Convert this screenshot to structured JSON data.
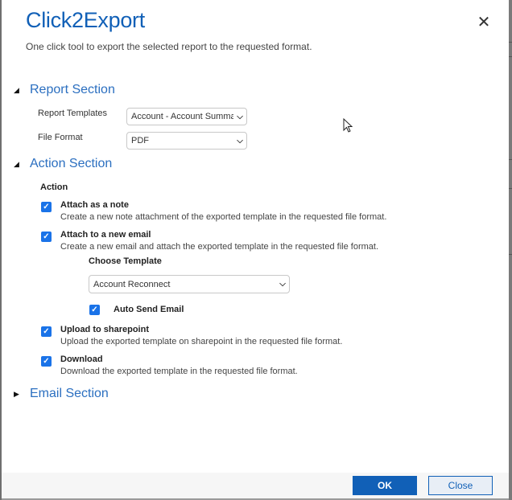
{
  "dialog": {
    "title": "Click2Export",
    "subtitle": "One click tool to export the selected report to the requested format.",
    "close_icon": "close-icon"
  },
  "report_section": {
    "title": "Report Section",
    "expanded": true,
    "fields": [
      {
        "label": "Report Templates",
        "value": "Account - Account Summary"
      },
      {
        "label": "File Format",
        "value": "PDF"
      }
    ]
  },
  "action_section": {
    "title": "Action Section",
    "expanded": true,
    "action_label": "Action",
    "options": [
      {
        "title": "Attach as a note",
        "desc": "Create a new note attachment of the exported template in the requested file format.",
        "checked": true
      },
      {
        "title": "Attach to a new email",
        "desc": "Create a new email and attach the exported template in the requested file format.",
        "checked": true
      },
      {
        "title": "Upload to sharepoint",
        "desc": "Upload the exported template on sharepoint in the requested file format.",
        "checked": true
      },
      {
        "title": "Download",
        "desc": "Download the exported template in the requested file format.",
        "checked": true
      }
    ],
    "choose_template_label": "Choose Template",
    "choose_template_value": "Account Reconnect",
    "auto_send_label": "Auto Send Email",
    "auto_send_checked": true
  },
  "email_section": {
    "title": "Email Section",
    "expanded": false
  },
  "footer": {
    "ok_label": "OK",
    "close_label": "Close"
  },
  "colors": {
    "accent": "#1160b7",
    "checkbox": "#1a73e8"
  }
}
